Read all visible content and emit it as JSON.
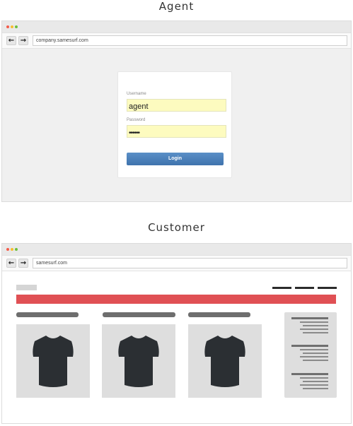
{
  "agent": {
    "title": "Agent",
    "browser": {
      "address": "company.samesurf.com",
      "back_label": "←",
      "forward_label": "→"
    },
    "login": {
      "username_label": "Username",
      "username_value": "agent",
      "password_label": "Password",
      "password_value": "••••••",
      "login_button": "Login"
    }
  },
  "customer": {
    "title": "Customer",
    "browser": {
      "address": "samesurf.com",
      "back_label": "←",
      "forward_label": "→"
    },
    "page": {
      "product_icon": "tshirt-icon",
      "accent_color": "#e05054",
      "products_count_visible": 3
    }
  },
  "colors": {
    "window_dot_red": "#f45c4a",
    "window_dot_yellow": "#f7bd2d",
    "window_dot_green": "#6bbf3f",
    "login_button": "#4a7fb8",
    "autofill_yellow": "#fdfbbf",
    "hero_red": "#e05054",
    "tshirt": "#2b2f33"
  }
}
